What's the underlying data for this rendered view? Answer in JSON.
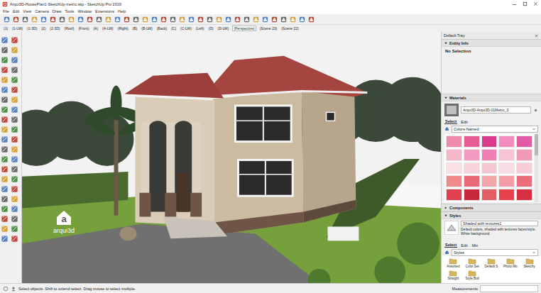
{
  "window": {
    "title": "Arqui3D-HousePlan1-SketchUp-metric.skp - SketchUp Pro 2019"
  },
  "menu": [
    "File",
    "Edit",
    "View",
    "Camera",
    "Draw",
    "Tools",
    "Window",
    "Extensions",
    "Help"
  ],
  "scenes": [
    {
      "label": "(1)",
      "selected": false
    },
    {
      "label": "(1-LW)",
      "selected": false
    },
    {
      "label": "(1-3D)",
      "selected": false
    },
    {
      "label": "(2)",
      "selected": false
    },
    {
      "label": "(2-3D)",
      "selected": false
    },
    {
      "label": "(Roof)",
      "selected": false
    },
    {
      "label": "(Front)",
      "selected": false
    },
    {
      "label": "(A)",
      "selected": false
    },
    {
      "label": "(A-LW)",
      "selected": false
    },
    {
      "label": "(Right)",
      "selected": false
    },
    {
      "label": "(B)",
      "selected": false
    },
    {
      "label": "(B-LW)",
      "selected": false
    },
    {
      "label": "(Back)",
      "selected": false
    },
    {
      "label": "(C)",
      "selected": false
    },
    {
      "label": "(C-LW)",
      "selected": false
    },
    {
      "label": "(Left)",
      "selected": false
    },
    {
      "label": "(D)",
      "selected": false
    },
    {
      "label": "(D-LW)",
      "selected": false
    },
    {
      "label": "(Perspective)",
      "selected": true
    },
    {
      "label": "(Scene 23)",
      "selected": false
    },
    {
      "label": "(Scene 22)",
      "selected": false
    }
  ],
  "viewport": {
    "logo_letter": "a",
    "watermark": "arqui3d"
  },
  "tray": {
    "title": "Default Tray",
    "entity_info": {
      "title": "Entity Info",
      "expanded": true,
      "selection": "No Selection"
    },
    "materials": {
      "title": "Materials",
      "expanded": true,
      "name": "Arqui3D-Arqui3D-01Metric_3",
      "tabs": [
        {
          "label": "Select",
          "selected": true
        },
        {
          "label": "Edit",
          "selected": false
        }
      ],
      "library": "Colors-Named",
      "swatches": [
        {
          "color": "#f08cab"
        },
        {
          "color": "#e85c95"
        },
        {
          "color": "#d93a8a"
        },
        {
          "color": "#f48cc0"
        },
        {
          "color": "#e05aa6"
        },
        {
          "color": "#f5b8c8"
        },
        {
          "color": "#f29ac0"
        },
        {
          "color": "#ef7fb4"
        },
        {
          "color": "#f7c3d6"
        },
        {
          "color": "#f09ab8"
        },
        {
          "color": "#fbe0e6"
        },
        {
          "color": "#f7d4dc"
        },
        {
          "color": "#f3c8d2"
        },
        {
          "color": "#f9dde4"
        },
        {
          "color": "#f7ccd6"
        },
        {
          "color": "#ef8b8b"
        },
        {
          "color": "#e86a78"
        },
        {
          "color": "#f2a6a8"
        },
        {
          "color": "#f49ca8"
        },
        {
          "color": "#ea6d7e"
        },
        {
          "color": "#e04050"
        },
        {
          "color": "#c8283c"
        },
        {
          "color": "#e45c64"
        },
        {
          "color": "#e8404c"
        },
        {
          "color": "#d83040"
        }
      ]
    },
    "components": {
      "title": "Components",
      "expanded": false
    },
    "styles": {
      "title": "Styles",
      "expanded": true,
      "name": "Shaded with textures1",
      "description": "Default colors, shaded with textures faces/style. White background.",
      "tabs": [
        {
          "label": "Select",
          "selected": true
        },
        {
          "label": "Edit",
          "selected": false
        },
        {
          "label": "Mix",
          "selected": false
        }
      ],
      "library": "Styles",
      "thumbnails": [
        "Assorted",
        "Color Set",
        "Default S",
        "Photo Mo",
        "Sketchy",
        "Straight",
        "Style Buil"
      ]
    }
  },
  "status_bar": {
    "hint": "Select objects. Shift to extend select. Drag mouse to select multiple.",
    "measurements": "Measurements"
  }
}
